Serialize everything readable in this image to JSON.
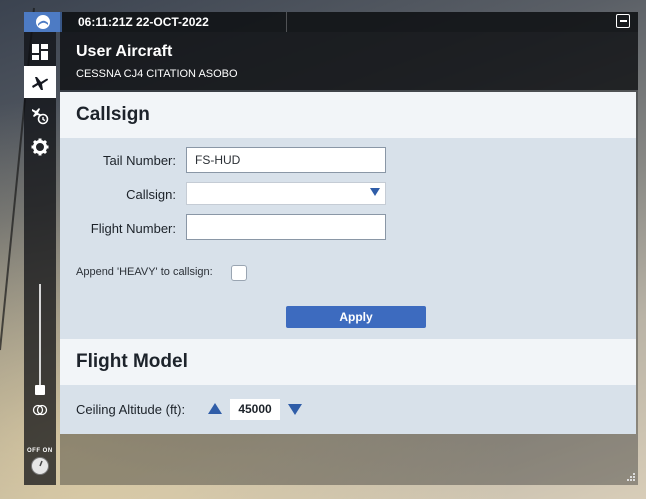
{
  "titlebar": {
    "time": "06:11:21Z 22-OCT-2022"
  },
  "header": {
    "title": "User Aircraft",
    "subtitle": "CESSNA CJ4 CITATION ASOBO"
  },
  "sidebar": {
    "items": [
      {
        "name": "dashboard-icon"
      },
      {
        "name": "user-aircraft-icon",
        "active": true
      },
      {
        "name": "traffic-icon"
      },
      {
        "name": "settings-icon"
      }
    ],
    "toggle": {
      "off_label": "OFF",
      "on_label": "ON"
    }
  },
  "callsign_section": {
    "title": "Callsign",
    "tail_number": {
      "label": "Tail Number:",
      "value": "FS-HUD"
    },
    "callsign": {
      "label": "Callsign:",
      "value": ""
    },
    "flight_number": {
      "label": "Flight Number:",
      "value": ""
    },
    "append_heavy": {
      "label": "Append 'HEAVY' to callsign:",
      "checked": false
    },
    "apply_label": "Apply"
  },
  "flight_model_section": {
    "title": "Flight Model",
    "ceiling": {
      "label": "Ceiling Altitude (ft):",
      "value": "45000"
    }
  },
  "colors": {
    "accent": "#3d6bbf",
    "panel": "#d8e1ea",
    "section_header": "#f2f5f8",
    "logo_bg": "#4d7bc4"
  }
}
